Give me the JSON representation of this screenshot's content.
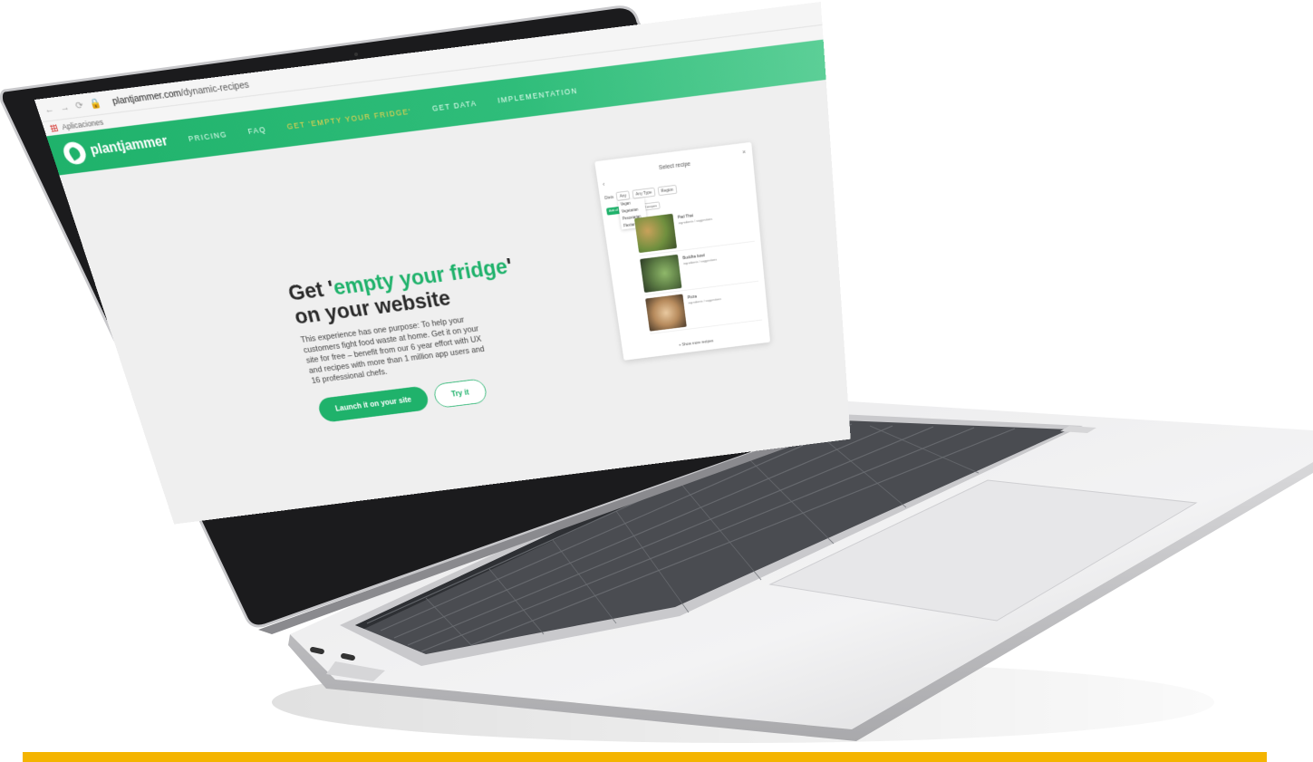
{
  "browser": {
    "url_host": "plantjammer.com",
    "url_path": "/dynamic-recipes",
    "bookmark_apps": "Aplicaciones"
  },
  "site": {
    "logo_text": "plantjammer",
    "nav": [
      "PRICING",
      "FAQ",
      "GET 'EMPTY YOUR FRIDGE'",
      "GET DATA",
      "IMPLEMENTATION"
    ],
    "hero": {
      "title_prefix": "Get '",
      "title_accent": "empty your fridge",
      "title_suffix": "'",
      "title_line2": "on your website",
      "body": "This experience has one purpose: To help your customers fight food waste at home. Get it on your site for free – benefit from our 6 year effort with UX and recipes with more than 1 million app users and 16 professional chefs.",
      "primary_cta": "Launch it on your site",
      "secondary_cta": "Try it"
    },
    "widget": {
      "title": "Select recipe",
      "close": "×",
      "back": "‹",
      "filter_label": "Diets",
      "filter_select": "Any",
      "filter_2": "Any Type",
      "filter_3": "Region",
      "dropdown": [
        "Vegan",
        "Vegetarian",
        "Pescetarian",
        "Flexitarian"
      ],
      "chip_1": "Add all",
      "chip_2": "Boost",
      "chip_3": "All recipes",
      "recipes": [
        {
          "title": "Pad Thai",
          "sub": "ingredients / suggestions"
        },
        {
          "title": "Buddha bowl",
          "sub": "ingredients / suggestions"
        },
        {
          "title": "Pizza",
          "sub": "ingredients / suggestions"
        }
      ],
      "more": "+ Show more recipes"
    }
  },
  "colors": {
    "brand_green": "#1fb26b",
    "accent_yellow": "#f4b400"
  }
}
